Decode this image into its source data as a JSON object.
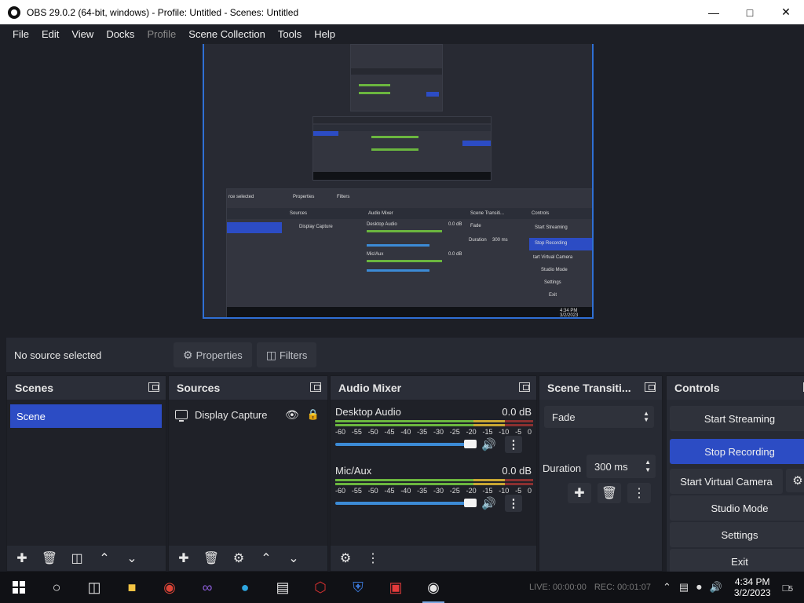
{
  "window": {
    "title": "OBS 29.0.2 (64-bit, windows) - Profile: Untitled - Scenes: Untitled"
  },
  "menu": [
    "File",
    "Edit",
    "View",
    "Docks",
    "Profile",
    "Scene Collection",
    "Tools",
    "Help"
  ],
  "context": {
    "no_source": "No source selected",
    "properties": "Properties",
    "filters": "Filters"
  },
  "scenes": {
    "title": "Scenes",
    "items": [
      "Scene"
    ]
  },
  "sources": {
    "title": "Sources",
    "items": [
      {
        "label": "Display Capture"
      }
    ]
  },
  "mixer": {
    "title": "Audio Mixer",
    "channels": [
      {
        "name": "Desktop Audio",
        "db": "0.0 dB",
        "volume": 1.0
      },
      {
        "name": "Mic/Aux",
        "db": "0.0 dB",
        "volume": 1.0
      }
    ],
    "scale": [
      "-60",
      "-55",
      "-50",
      "-45",
      "-40",
      "-35",
      "-30",
      "-25",
      "-20",
      "-15",
      "-10",
      "-5",
      "0"
    ]
  },
  "transitions": {
    "title": "Scene Transiti...",
    "selected": "Fade",
    "duration_label": "Duration",
    "duration": "300 ms"
  },
  "controls": {
    "title": "Controls",
    "start_streaming": "Start Streaming",
    "stop_recording": "Stop Recording",
    "virtual_camera": "Start Virtual Camera",
    "studio_mode": "Studio Mode",
    "settings": "Settings",
    "exit": "Exit"
  },
  "preview_nested": {
    "no_source": "rce selected",
    "properties": "Properties",
    "filters": "Filters",
    "sources": "Sources",
    "display_capture": "Display Capture",
    "audio_mixer": "Audio Mixer",
    "desktop_audio": "Desktop Audio",
    "mic_aux": "Mic/Aux",
    "db": "0.0 dB",
    "scene_transitions": "Scene Transiti...",
    "fade": "Fade",
    "duration": "Duration",
    "duration_value": "300 ms",
    "controls": "Controls",
    "start_streaming": "Start Streaming",
    "stop_recording": "Stop Recording",
    "virtual_camera": "tart Virtual Camera",
    "studio_mode": "Studio Mode",
    "settings": "Settings",
    "exit": "Exit",
    "clock_time": "4:34 PM",
    "clock_date": "3/2/2023"
  },
  "taskbar": {
    "live": "LIVE: 00:00:00",
    "rec": "REC: 00:01:07",
    "time": "4:34 PM",
    "date": "3/2/2023",
    "notifications": "5"
  },
  "colors": {
    "accent": "#2c4cc4",
    "background": "#1d1f26",
    "dock": "#272a33"
  }
}
